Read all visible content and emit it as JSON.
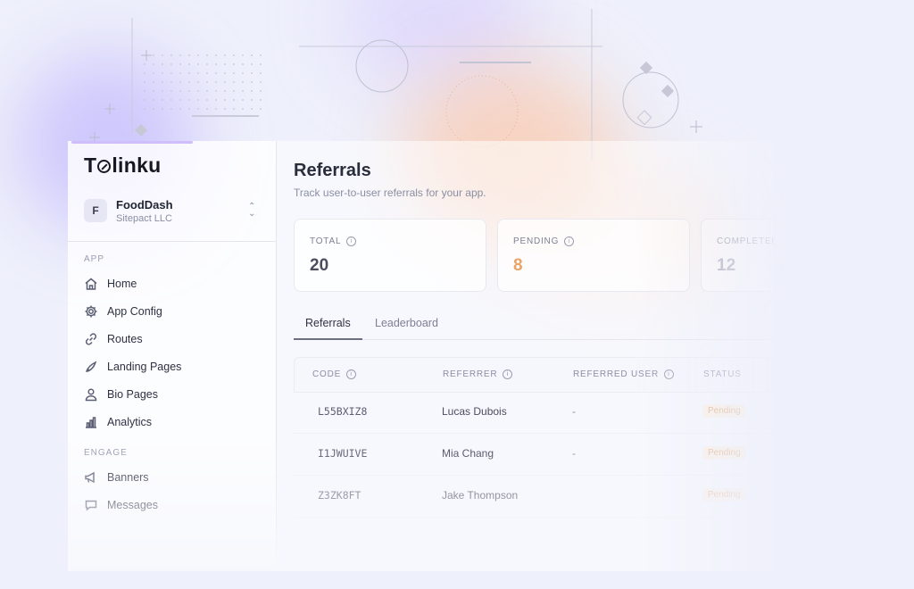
{
  "app": {
    "logo": "Tolinku",
    "workspace": {
      "initial": "F",
      "name": "FoodDash",
      "org": "Sitepact LLC"
    }
  },
  "sidebar": {
    "sections": [
      {
        "label": "APP"
      },
      {
        "label": "ENGAGE"
      }
    ],
    "items": [
      {
        "label": "Home",
        "icon": "home-icon"
      },
      {
        "label": "App Config",
        "icon": "gear-icon"
      },
      {
        "label": "Routes",
        "icon": "link-icon"
      },
      {
        "label": "Landing Pages",
        "icon": "rocket-icon"
      },
      {
        "label": "Bio Pages",
        "icon": "user-icon"
      },
      {
        "label": "Analytics",
        "icon": "bar-chart-icon"
      },
      {
        "label": "Banners",
        "icon": "megaphone-icon"
      },
      {
        "label": "Messages",
        "icon": "message-icon"
      }
    ]
  },
  "main": {
    "title": "Referrals",
    "subtitle": "Track user-to-user referrals for your app.",
    "stats": [
      {
        "label": "TOTAL",
        "value": "20",
        "color": "#4a4d5e"
      },
      {
        "label": "PENDING",
        "value": "8",
        "color": "#e9a467"
      },
      {
        "label": "COMPLETED",
        "value": "12",
        "color": "#9a9db0"
      }
    ],
    "tabs": [
      {
        "label": "Referrals",
        "active": true
      },
      {
        "label": "Leaderboard",
        "active": false
      }
    ],
    "table": {
      "headers": [
        "CODE",
        "REFERRER",
        "REFERRED USER",
        "STATUS"
      ],
      "rows": [
        {
          "code": "L55BXIZ8",
          "referrer": "Lucas Dubois",
          "referred": "-",
          "status": "Pending"
        },
        {
          "code": "I1JWUIVE",
          "referrer": "Mia Chang",
          "referred": "-",
          "status": "Pending"
        },
        {
          "code": "Z3ZK8FT",
          "referrer": "Jake Thompson",
          "referred": "",
          "status": "Pending"
        }
      ]
    }
  }
}
